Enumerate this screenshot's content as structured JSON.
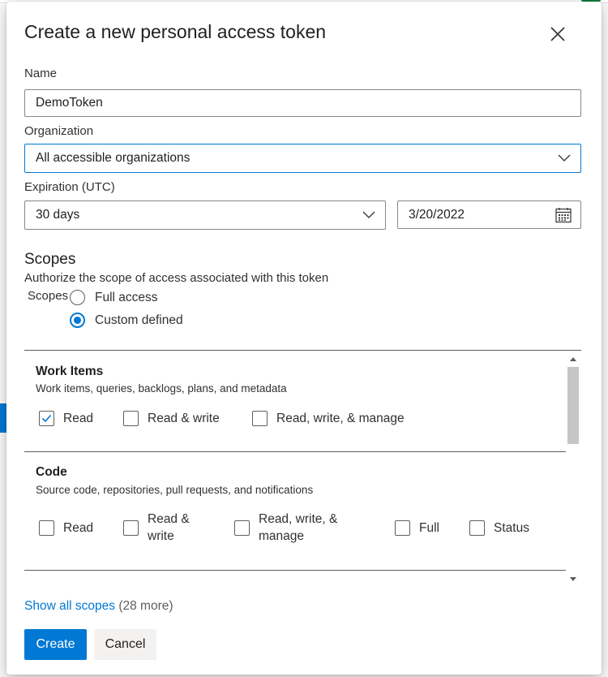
{
  "dialog": {
    "title": "Create a new personal access token"
  },
  "form": {
    "name_label": "Name",
    "name_value": "DemoToken",
    "organization_label": "Organization",
    "organization_value": "All accessible organizations",
    "expiration_label": "Expiration (UTC)",
    "expiration_value": "30 days",
    "expiration_date": "3/20/2022"
  },
  "scopes": {
    "title": "Scopes",
    "description": "Authorize the scope of access associated with this token",
    "field_label": "Scopes",
    "options": [
      {
        "label": "Full access",
        "selected": false
      },
      {
        "label": "Custom defined",
        "selected": true
      }
    ],
    "groups": [
      {
        "title": "Work Items",
        "description": "Work items, queries, backlogs, plans, and metadata",
        "permissions": [
          {
            "label": "Read",
            "checked": true
          },
          {
            "label": "Read & write",
            "checked": false
          },
          {
            "label": "Read, write, & manage",
            "checked": false
          }
        ]
      },
      {
        "title": "Code",
        "description": "Source code, repositories, pull requests, and notifications",
        "permissions": [
          {
            "label": "Read",
            "checked": false
          },
          {
            "label": "Read & write",
            "checked": false
          },
          {
            "label": "Read, write, & manage",
            "checked": false
          },
          {
            "label": "Full",
            "checked": false
          },
          {
            "label": "Status",
            "checked": false
          }
        ]
      }
    ],
    "show_all_link": "Show all scopes",
    "more_count": "(28 more)"
  },
  "actions": {
    "create_label": "Create",
    "cancel_label": "Cancel"
  },
  "colors": {
    "accent": "#0078d4",
    "text": "#201f1e",
    "border": "#8a8886"
  }
}
